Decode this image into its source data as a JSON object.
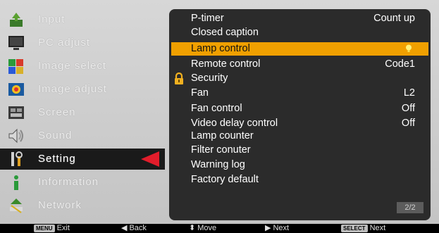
{
  "left_menu": {
    "items": [
      {
        "label": "Input",
        "icon": "input-icon"
      },
      {
        "label": "PC adjust",
        "icon": "pc-adjust-icon"
      },
      {
        "label": "Image select",
        "icon": "image-select-icon"
      },
      {
        "label": "Image adjust",
        "icon": "image-adjust-icon"
      },
      {
        "label": "Screen",
        "icon": "screen-icon"
      },
      {
        "label": "Sound",
        "icon": "sound-icon"
      },
      {
        "label": "Setting",
        "icon": "setting-icon"
      },
      {
        "label": "Information",
        "icon": "information-icon"
      },
      {
        "label": "Network",
        "icon": "network-icon"
      }
    ],
    "active": "Setting"
  },
  "submenu": {
    "rows": [
      {
        "label": "P-timer",
        "value": "Count up"
      },
      {
        "label": "Closed caption",
        "value": ""
      },
      {
        "label": "Lamp control",
        "value": "",
        "icon": "lamp-icon"
      },
      {
        "label": "Remote control",
        "value": "Code1"
      },
      {
        "label": "Security",
        "value": "",
        "icon": "lock-icon"
      },
      {
        "label": "Fan",
        "value": "L2"
      },
      {
        "label": "Fan control",
        "value": "Off"
      },
      {
        "label": "Video delay control",
        "value": "Off"
      },
      {
        "label": "Lamp counter",
        "value": ""
      },
      {
        "label": "Filter conuter",
        "value": ""
      },
      {
        "label": "Warning log",
        "value": ""
      },
      {
        "label": "Factory default",
        "value": ""
      }
    ],
    "page": "2/2"
  },
  "bottom_bar": {
    "menu_key": "MENU",
    "exit": "Exit",
    "back": "Back",
    "move": "Move",
    "next_arrow": "Next",
    "select_key": "SELECT",
    "next_select": "Next"
  },
  "colors": {
    "highlight": "#f0a000",
    "pointer": "#e21d2b",
    "panel": "#2b2b2b"
  }
}
